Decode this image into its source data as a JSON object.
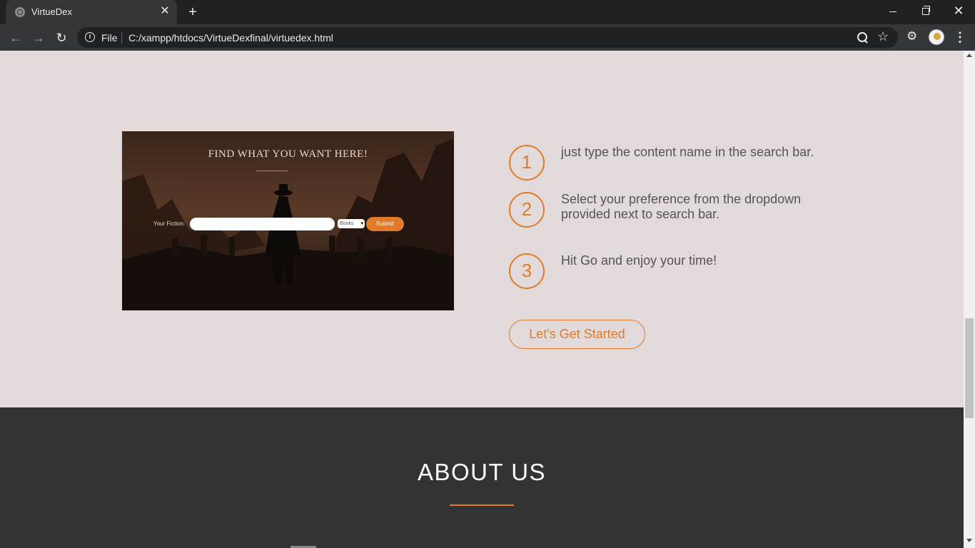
{
  "browser": {
    "tab_title": "VirtueDex",
    "tab_close": "✕",
    "new_tab": "+",
    "scheme_label": "File",
    "url": "C:/xampp/htdocs/VirtueDexfinal/virtuedex.html",
    "icons": [
      "globe-icon",
      "back-icon",
      "forward-icon",
      "reload-icon",
      "info-icon",
      "zoom-icon",
      "star-icon",
      "extensions-icon",
      "avatar",
      "menu-icon"
    ]
  },
  "hero_image": {
    "heading": "FIND WHAT YOU WANT HERE!",
    "field_label": "Your Fiction:",
    "select_value": "Books",
    "submit_label": "Submit"
  },
  "steps": [
    {
      "number": "1",
      "text": "just type the content name in the search bar."
    },
    {
      "number": "2",
      "text": "Select your preference from the dropdown provided next to search bar."
    },
    {
      "number": "3",
      "text": "Hit Go and enjoy your time!"
    }
  ],
  "cta_label": "Let's Get Started",
  "about": {
    "title": "ABOUT US"
  },
  "colors": {
    "accent": "#e07b2a",
    "light_bg": "#e2dada",
    "dark_bg": "#333333",
    "step_text": "#555555"
  }
}
